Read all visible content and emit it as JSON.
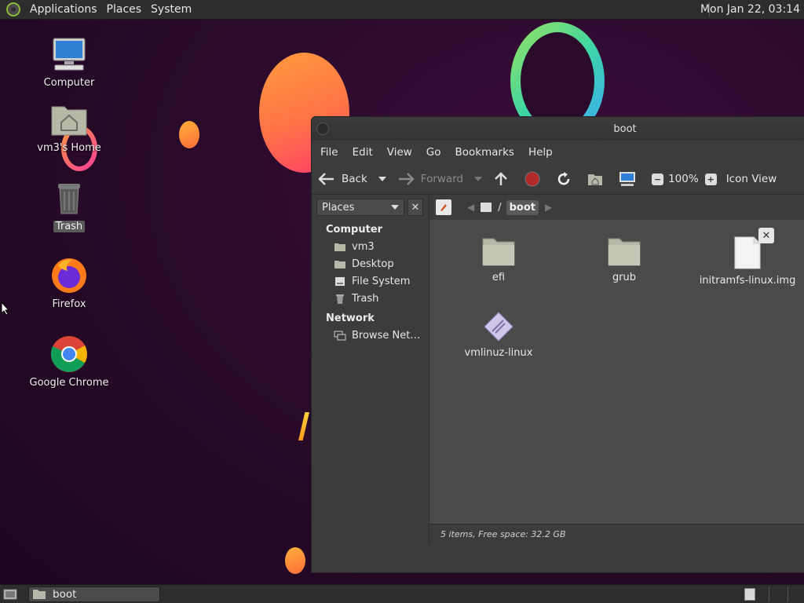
{
  "top_panel": {
    "menus": [
      "Applications",
      "Places",
      "System"
    ],
    "clock": "Mon Jan 22, 03:14"
  },
  "desktop_icons": [
    {
      "label": "Computer",
      "icon": "computer-icon"
    },
    {
      "label": "vm3's Home",
      "icon": "home-folder-icon"
    },
    {
      "label": "Trash",
      "icon": "trash-icon",
      "selected": true
    },
    {
      "label": "Firefox",
      "icon": "firefox-icon"
    },
    {
      "label": "Google Chrome",
      "icon": "chrome-icon"
    }
  ],
  "window": {
    "title": "boot",
    "menus": [
      "File",
      "Edit",
      "View",
      "Go",
      "Bookmarks",
      "Help"
    ],
    "toolbar": {
      "back": "Back",
      "forward": "Forward",
      "zoom": "100%",
      "view_mode": "Icon View"
    },
    "sidebar": {
      "selector": "Places",
      "sections": [
        {
          "heading": "Computer",
          "items": [
            {
              "label": "vm3",
              "icon": "home-icon"
            },
            {
              "label": "Desktop",
              "icon": "desktop-icon"
            },
            {
              "label": "File System",
              "icon": "drive-icon"
            },
            {
              "label": "Trash",
              "icon": "trash-icon"
            }
          ]
        },
        {
          "heading": "Network",
          "items": [
            {
              "label": "Browse Net…",
              "icon": "network-icon"
            }
          ]
        }
      ]
    },
    "path": {
      "separator": "/",
      "current": "boot"
    },
    "files": [
      {
        "name": "efi",
        "type": "folder"
      },
      {
        "name": "grub",
        "type": "folder"
      },
      {
        "name": "initramfs-linux.img",
        "type": "file"
      },
      {
        "name": "vmlinuz-linux",
        "type": "binary"
      }
    ],
    "status": "5 items, Free space: 32.2 GB"
  },
  "bottom_panel": {
    "task": "boot"
  },
  "colors": {
    "panel": "#2d2d2d",
    "window_bg": "#3c3c3c",
    "content_bg": "#4a4a4a",
    "wallpaper": "#2a0a2a"
  }
}
